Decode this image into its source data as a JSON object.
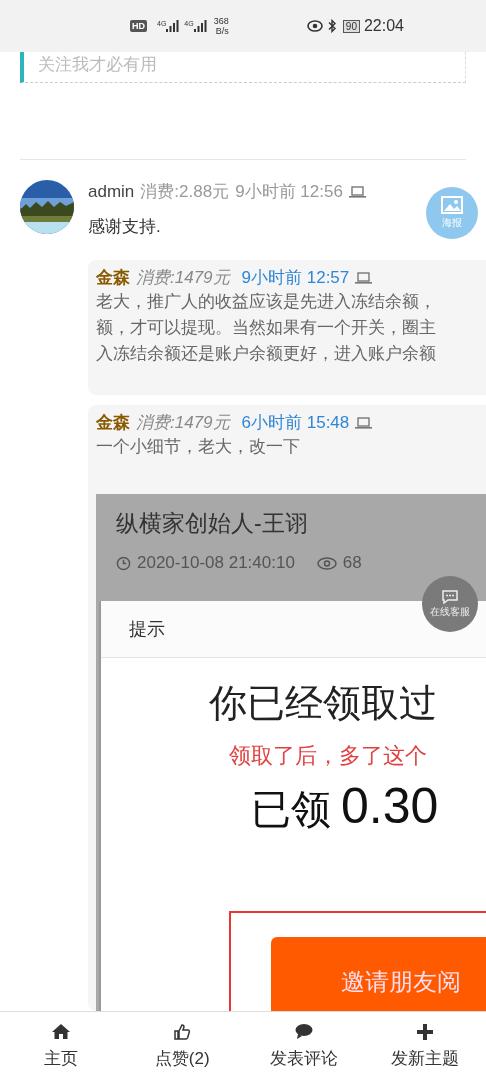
{
  "status_bar": {
    "hd_label": "HD",
    "signals": [
      "4G",
      "4G"
    ],
    "network_speed": "368",
    "speed_unit": "B/s",
    "battery": "90",
    "time": "22:04"
  },
  "notice": {
    "text": "关注我才必有用"
  },
  "comment": {
    "author": "admin",
    "spend": "消费:2.88元",
    "time": "9小时前 12:56",
    "text": "感谢支持."
  },
  "poster_button": {
    "label": "海报"
  },
  "replies": [
    {
      "author": "金森",
      "spend": "消费:1479元",
      "time": "9小时前 12:57",
      "lines": [
        "老大，推广人的收益应该是先进入冻结余额，",
        "额，才可以提现。当然如果有一个开关，圈主",
        "入冻结余额还是账户余额更好，进入账户余额"
      ]
    },
    {
      "author": "金森",
      "spend": "消费:1479元",
      "time": "6小时前 15:48",
      "lines": [
        "一个小细节，老大，改一下"
      ],
      "screenshot": {
        "title": "纵横家创始人-王诩",
        "date": "2020-10-08 21:40:10",
        "views": "68",
        "chat_label": "在线客服",
        "dialog_title": "提示",
        "heading": "你已经领取过",
        "note": "领取了后，多了这个",
        "amount_label": "已领",
        "amount": "0.30",
        "button": "邀请朋友阅"
      }
    }
  ],
  "nav": [
    {
      "kind": "home",
      "label": "主页"
    },
    {
      "kind": "like",
      "label": "点赞(2)"
    },
    {
      "kind": "comment",
      "label": "发表评论"
    },
    {
      "kind": "post",
      "label": "发新主题"
    }
  ]
}
